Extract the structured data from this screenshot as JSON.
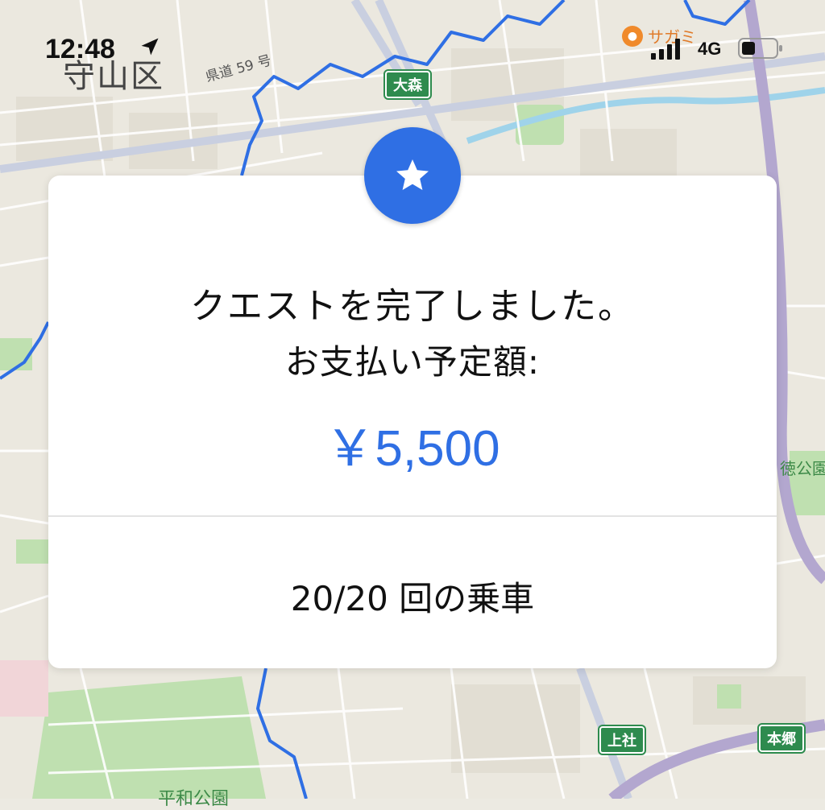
{
  "status_bar": {
    "time": "12:48",
    "network": "4G",
    "location_icon": "location-arrow-icon",
    "signal_icon": "cellular-signal-icon",
    "battery_icon": "battery-icon"
  },
  "map": {
    "ward_label": "守山区",
    "road_label": "県道 59 号",
    "poi_label": "サガミ",
    "park_label_right": "徳公園",
    "park_label_bottom": "平和公園",
    "stations": [
      "大森",
      "上社",
      "本郷"
    ]
  },
  "card": {
    "badge_icon": "star-icon",
    "message": "クエストを完了しました。",
    "payment_label": "お支払い予定額:",
    "amount": "￥5,500",
    "rides": "20/20 回の乗車"
  },
  "colors": {
    "accent": "#2f6fe4",
    "station_green": "#2e8b4e",
    "route_blue": "#2f6fe4",
    "map_bg": "#eceae2"
  }
}
